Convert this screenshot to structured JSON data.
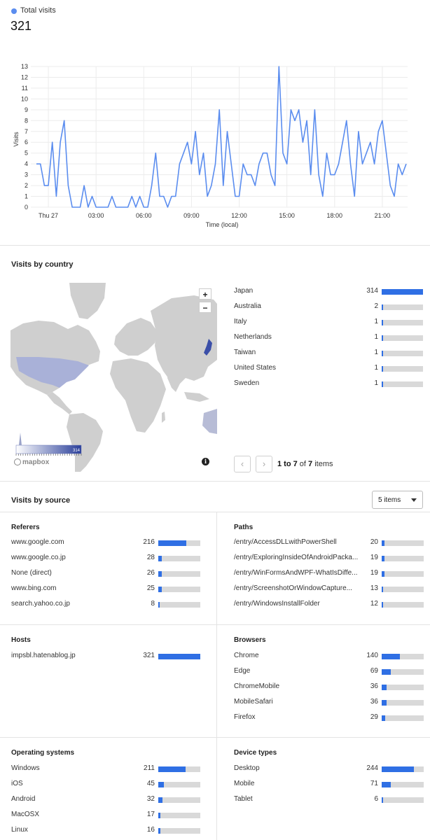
{
  "total_visits": {
    "legend_label": "Total visits",
    "value": "321",
    "legend_color": "#5b8def"
  },
  "chart_data": {
    "type": "line",
    "xlabel": "Time (local)",
    "ylabel": "Visits",
    "ylim": [
      0,
      13
    ],
    "yticks": [
      0,
      1,
      2,
      3,
      4,
      5,
      6,
      7,
      8,
      9,
      10,
      11,
      12,
      13
    ],
    "x_tick_labels": [
      {
        "label": "Thu 27",
        "index": 3
      },
      {
        "label": "03:00",
        "index": 15
      },
      {
        "label": "06:00",
        "index": 27
      },
      {
        "label": "09:00",
        "index": 39
      },
      {
        "label": "12:00",
        "index": 51
      },
      {
        "label": "15:00",
        "index": 63
      },
      {
        "label": "18:00",
        "index": 75
      },
      {
        "label": "21:00",
        "index": 87
      }
    ],
    "grid": true,
    "line_color": "#5b8def",
    "series": [
      {
        "values": [
          4,
          4,
          2,
          2,
          6,
          1,
          6,
          8,
          2,
          0,
          0,
          0,
          2,
          0,
          1,
          0,
          0,
          0,
          0,
          1,
          0,
          0,
          0,
          0,
          1,
          0,
          1,
          0,
          0,
          2,
          5,
          1,
          1,
          0,
          1,
          1,
          4,
          5,
          6,
          4,
          7,
          3,
          5,
          1,
          2,
          4,
          9,
          2,
          7,
          4,
          1,
          1,
          4,
          3,
          3,
          2,
          4,
          5,
          5,
          3,
          2,
          13,
          5,
          4,
          9,
          8,
          9,
          6,
          8,
          3,
          9,
          3,
          1,
          5,
          3,
          3,
          4,
          6,
          8,
          4,
          1,
          7,
          4,
          5,
          6,
          4,
          7,
          8,
          5,
          2,
          1,
          4,
          3,
          4
        ]
      }
    ]
  },
  "countries": {
    "title": "Visits by country",
    "max": 314,
    "items": [
      {
        "name": "Japan",
        "value": 314
      },
      {
        "name": "Australia",
        "value": 2
      },
      {
        "name": "Italy",
        "value": 1
      },
      {
        "name": "Netherlands",
        "value": 1
      },
      {
        "name": "Taiwan",
        "value": 1
      },
      {
        "name": "United States",
        "value": 1
      },
      {
        "name": "Sweden",
        "value": 1
      }
    ],
    "pager": {
      "range": "1 to 7",
      "of": "of",
      "total": "7",
      "suffix": "items"
    },
    "map": {
      "zoom_in": "+",
      "zoom_out": "−",
      "scale_max": "314",
      "logo": "mapbox",
      "info": "i",
      "land_color": "#cfcfcf",
      "highlight_color": "#3b4fa8"
    }
  },
  "sources": {
    "title": "Visits by source",
    "select_value": "5 items",
    "referers": {
      "title": "Referers",
      "max": 321,
      "items": [
        {
          "name": "www.google.com",
          "value": 216
        },
        {
          "name": "www.google.co.jp",
          "value": 28
        },
        {
          "name": "None (direct)",
          "value": 26
        },
        {
          "name": "www.bing.com",
          "value": 25
        },
        {
          "name": "search.yahoo.co.jp",
          "value": 8
        }
      ]
    },
    "paths": {
      "title": "Paths",
      "max": 321,
      "items": [
        {
          "name": "/entry/AccessDLLwithPowerShell",
          "value": 20
        },
        {
          "name": "/entry/ExploringInsideOfAndroidPacka...",
          "value": 19
        },
        {
          "name": "/entry/WinFormsAndWPF-WhatIsDiffe...",
          "value": 19
        },
        {
          "name": "/entry/ScreenshotOrWindowCapture...",
          "value": 13
        },
        {
          "name": "/entry/WindowsInstallFolder",
          "value": 12
        }
      ]
    },
    "hosts": {
      "title": "Hosts",
      "max": 321,
      "items": [
        {
          "name": "impsbl.hatenablog.jp",
          "value": 321
        }
      ]
    },
    "browsers": {
      "title": "Browsers",
      "max": 321,
      "items": [
        {
          "name": "Chrome",
          "value": 140
        },
        {
          "name": "Edge",
          "value": 69
        },
        {
          "name": "ChromeMobile",
          "value": 36
        },
        {
          "name": "MobileSafari",
          "value": 36
        },
        {
          "name": "Firefox",
          "value": 29
        }
      ]
    },
    "os": {
      "title": "Operating systems",
      "max": 321,
      "items": [
        {
          "name": "Windows",
          "value": 211
        },
        {
          "name": "iOS",
          "value": 45
        },
        {
          "name": "Android",
          "value": 32
        },
        {
          "name": "MacOSX",
          "value": 17
        },
        {
          "name": "Linux",
          "value": 16
        }
      ]
    },
    "devices": {
      "title": "Device types",
      "max": 321,
      "items": [
        {
          "name": "Desktop",
          "value": 244
        },
        {
          "name": "Mobile",
          "value": 71
        },
        {
          "name": "Tablet",
          "value": 6
        }
      ]
    }
  }
}
